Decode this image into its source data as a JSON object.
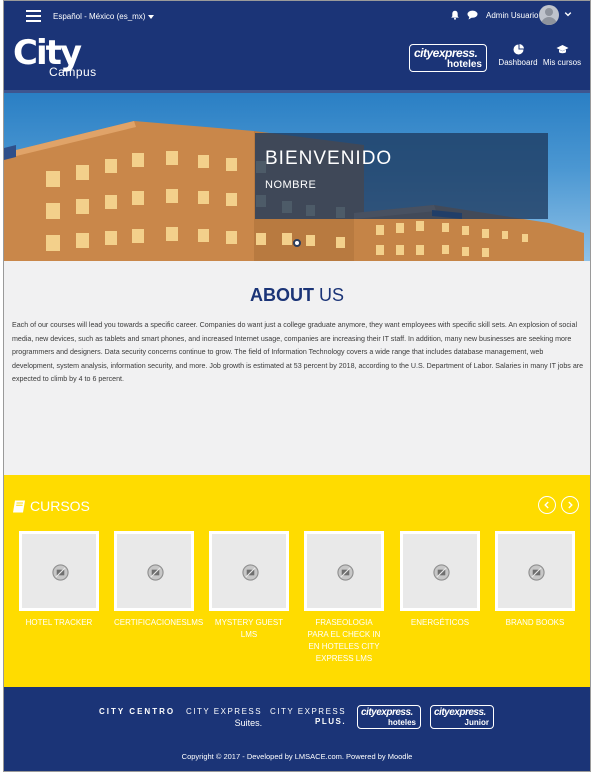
{
  "topbar": {
    "language": "Español - México (es_mx)",
    "user_name": "Admin Usuario"
  },
  "header": {
    "logo_main": "City",
    "logo_sub": "Campus",
    "brand_badge_line1": "cityexpress.",
    "brand_badge_line2": "hoteles",
    "nav": [
      {
        "label": "Dashboard",
        "icon": "dashboard-icon"
      },
      {
        "label": "Mis cursos",
        "icon": "graduation-cap-icon"
      }
    ]
  },
  "hero": {
    "title": "BIENVENIDO",
    "subtitle": "NOMBRE"
  },
  "about": {
    "title_bold": "ABOUT",
    "title_rest": " US",
    "body": "Each of our courses will lead you towards a specific career. Companies do want just a college graduate anymore, they want employees with specific skill sets. An explosion of social media, new devices, such as tablets and smart phones, and increased Internet usage, companies are increasing their IT staff. In addition, many new businesses are seeking more programmers and designers. Data security concerns continue to grow. The field of Information Technology covers a wide range that includes database management, web development, system analysis, information security, and more. Job growth is estimated at 53 percent by 2018, according to the U.S. Department of Labor. Salaries in many IT jobs are expected to climb by 4 to 6 percent."
  },
  "courses": {
    "heading": "CURSOS",
    "items": [
      {
        "title": "HOTEL TRACKER"
      },
      {
        "title": "CERTIFICACIONESLMS"
      },
      {
        "title": "MYSTERY GUEST LMS"
      },
      {
        "title": "FRASEOLOGIA PARA EL CHECK IN EN HOTELES CITY EXPRESS LMS"
      },
      {
        "title": "ENERGÉTICOS"
      },
      {
        "title": "BRAND BOOKS"
      }
    ]
  },
  "footer": {
    "brands": {
      "centro": "CITY CENTRO",
      "suites_1": "CITY EXPRESS",
      "suites_2": "Suites.",
      "plus_1": "CITY EXPRESS",
      "plus_2": "PLUS.",
      "hoteles_1": "cityexpress.",
      "hoteles_2": "hoteles",
      "junior_1": "cityexpress.",
      "junior_2": "Junior"
    },
    "copyright": "Copyright © 2017 - Developed by LMSACE.com. Powered by Moodle"
  },
  "colors": {
    "navy": "#1b3477",
    "yellow": "#ffdc00",
    "background": "#f1f1f2"
  }
}
